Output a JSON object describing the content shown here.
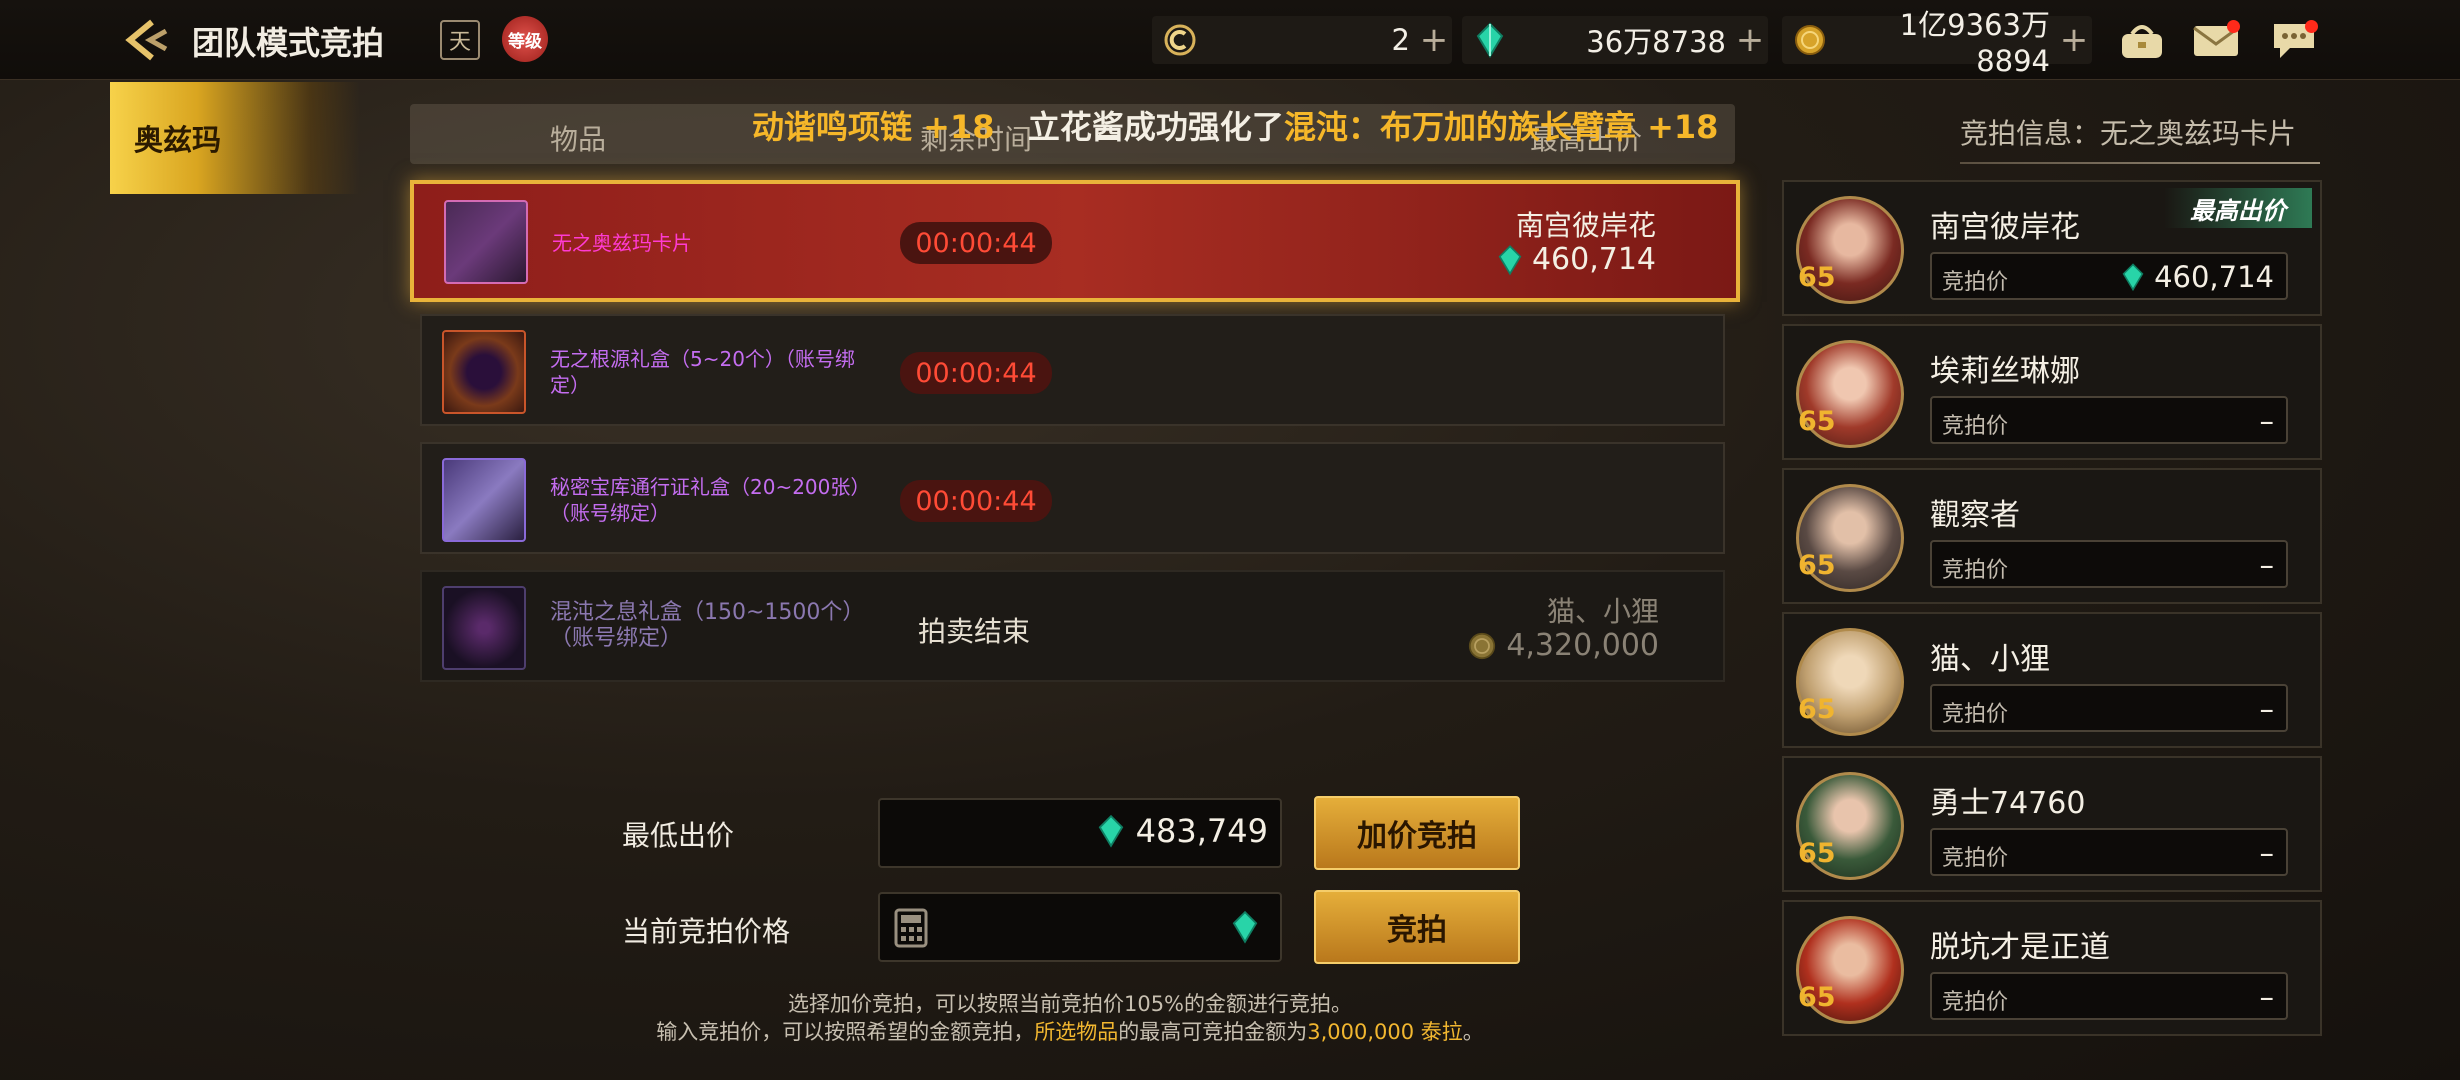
{
  "header": {
    "title": "团队模式竞拍",
    "calendar_icon_text": "天",
    "level_icon_text": "等级",
    "currencies": [
      {
        "name": "c-coin-icon",
        "value": "2"
      },
      {
        "name": "gem-icon",
        "value": "36万8738"
      },
      {
        "name": "gold-coin-icon",
        "value": "1亿9363万8894"
      }
    ]
  },
  "sidebar": {
    "tab_label": "奥兹玛"
  },
  "table": {
    "col_item": "物品",
    "col_time": "剩余时间",
    "col_bid": "最高出价",
    "ticker_prefix": "动谐鸣项链 +18",
    "ticker_main": "立花酱成功强化了",
    "ticker_item": "混沌：布万加的族长臂章 +18"
  },
  "rows": [
    {
      "name": "无之奥兹玛卡片",
      "timer": "00:00:44",
      "bidder": "南宫彼岸花",
      "amount": "460,714",
      "currency": "gem-icon"
    },
    {
      "name": "无之根源礼盒（5~20个）（账号绑定）",
      "timer": "00:00:44"
    },
    {
      "name": "秘密宝库通行证礼盒（20~200张）（账号绑定）",
      "timer": "00:00:44"
    },
    {
      "name": "混沌之息礼盒（150~1500个）（账号绑定）",
      "status": "拍卖结束",
      "bidder": "猫、小狸",
      "amount": "4,320,000",
      "currency": "gold-coin-icon"
    }
  ],
  "form": {
    "min_bid_label": "最低出价",
    "min_bid_value": "483,749",
    "raise_button": "加价竞拍",
    "current_bid_label": "当前竞拍价格",
    "bid_button": "竞拍",
    "hint1": "选择加价竞拍，可以按照当前竞拍价105%的金额进行竞拍。",
    "hint2_a": "输入竞拍价，可以按照希望的金额竞拍，",
    "hint2_b": "所选物品",
    "hint2_c": "的最高可竞拍金额为",
    "hint2_d": "3,000,000 泰拉",
    "hint2_e": "。"
  },
  "bid_info": {
    "title": "竞拍信息：无之奥兹玛卡片",
    "bid_label": "竞拍价",
    "top_badge": "最高出价",
    "players": [
      {
        "name": "南宫彼岸花",
        "level": "65",
        "bid": "460,714"
      },
      {
        "name": "埃莉丝琳娜",
        "level": "65",
        "bid": "–"
      },
      {
        "name": "觀察者",
        "level": "65",
        "bid": "–"
      },
      {
        "name": "猫、小狸",
        "level": "65",
        "bid": "–"
      },
      {
        "name": "勇士74760",
        "level": "65",
        "bid": "–"
      },
      {
        "name": "脱坑才是正道",
        "level": "65",
        "bid": "–"
      }
    ]
  }
}
